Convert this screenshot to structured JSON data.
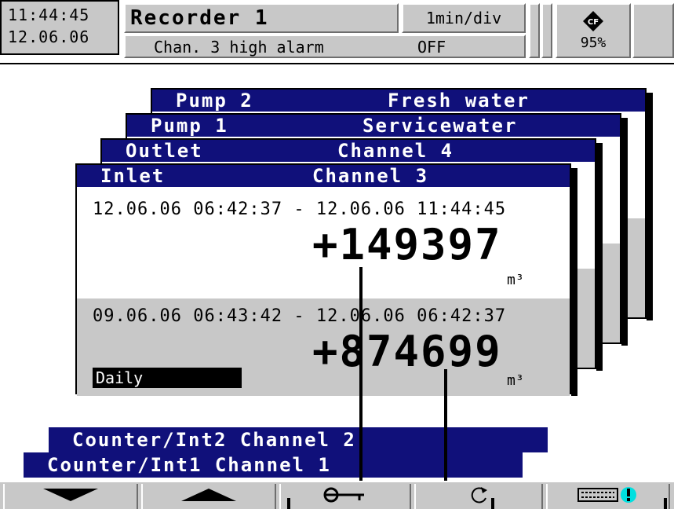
{
  "header": {
    "time": "11:44:45",
    "date": "12.06.06",
    "title": "Recorder 1",
    "speed": "1min/div",
    "status_message": "Chan. 3 high alarm",
    "status_value": "OFF",
    "memory_percent": "95%"
  },
  "cards": [
    {
      "left": "Pump 2",
      "right": "Fresh water"
    },
    {
      "left": "Pump 1",
      "right": "Servicewater"
    },
    {
      "left": "Outlet",
      "right": "Channel 4"
    },
    {
      "left": "Inlet",
      "right": "Channel 3"
    }
  ],
  "front_card": {
    "period1_range": "12.06.06 06:42:37  - 12.06.06 11:44:45",
    "period1_value": "+149397",
    "period1_unit": "m³",
    "period2_range": "09.06.06 06:43:42  - 12.06.06 06:42:37",
    "period2_value": "+874699",
    "period2_unit": "m³",
    "period2_label": "Daily"
  },
  "counters": [
    "Counter/Int2 Channel 2",
    "Counter/Int1 Channel 1"
  ],
  "bottom_buttons": [
    {
      "icon": "arrow-down-icon"
    },
    {
      "icon": "arrow-up-icon"
    },
    {
      "icon": "key-icon"
    },
    {
      "icon": "refresh-icon"
    },
    {
      "icon": "memory-alert-icon"
    }
  ],
  "colors": {
    "title_bar": "#10107a",
    "panel_gray": "#c8c8c8",
    "alert_cyan": "#00e0e0"
  }
}
